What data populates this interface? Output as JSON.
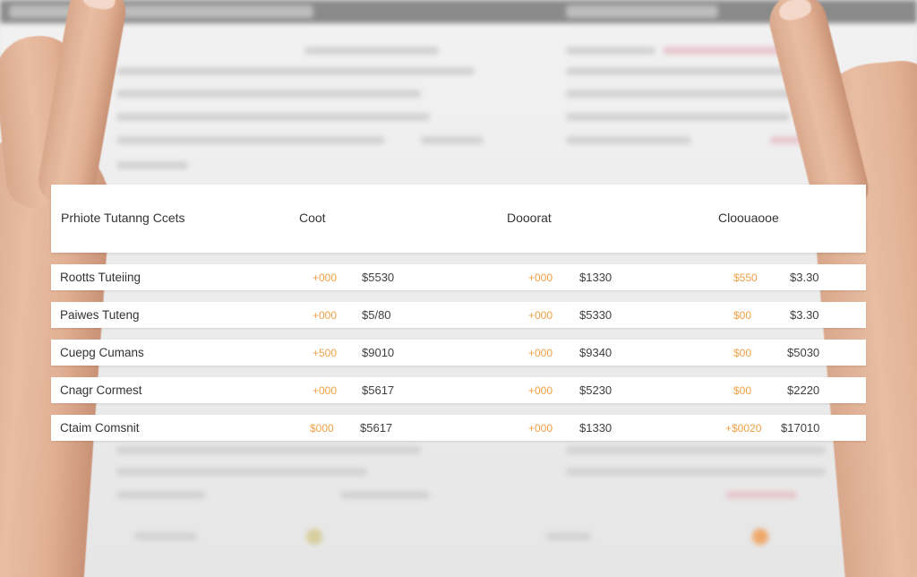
{
  "table": {
    "header": {
      "name": "Prhiote Tutanng Ccets",
      "col1": "Coot",
      "col2": "Dooorat",
      "col3": "Cloouaooe"
    },
    "rows": [
      {
        "label": "Rootts Tuteiing",
        "o1": "+000",
        "p1": "$5530",
        "o2": "+000",
        "p2": "$1330",
        "o3": "$550",
        "p3": "$3.30"
      },
      {
        "label": "Paiwes Tuteng",
        "o1": "+000",
        "p1": "$5/80",
        "o2": "+000",
        "p2": "$5330",
        "o3": "$00",
        "p3": "$3.30"
      },
      {
        "label": "Cuepg Cumans",
        "o1": "+500",
        "p1": "$9010",
        "o2": "+000",
        "p2": "$9340",
        "o3": "$00",
        "p3": "$5030"
      },
      {
        "label": "Cnagr Cormest",
        "o1": "+000",
        "p1": "$5617",
        "o2": "+000",
        "p2": "$5230",
        "o3": "$00",
        "p3": "$2220"
      },
      {
        "label": "Ctaim Comsnit",
        "o1": "$000",
        "p1": "$5617",
        "o2": "+000",
        "p2": "$1330",
        "o3": "+$0020",
        "p3": "$17010"
      }
    ]
  }
}
